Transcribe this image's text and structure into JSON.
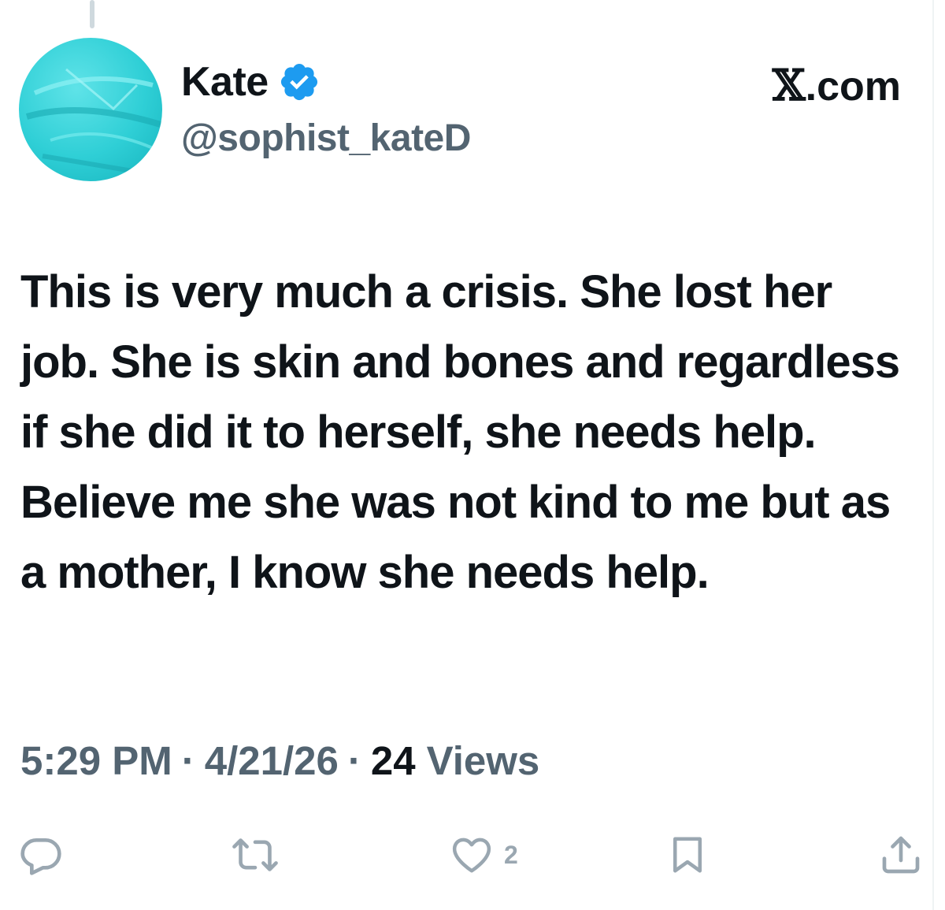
{
  "author": {
    "display_name": "Kate",
    "handle": "@sophist_kateD",
    "verified": true,
    "verified_icon": "verified-badge-icon",
    "avatar_color": "#2fcfd6"
  },
  "source": {
    "logo_letter": "𝕏",
    "domain": ".com"
  },
  "tweet": {
    "text": "This is very much a crisis. She lost her job. She is skin and bones and regardless if she did it to herself, she needs help. Believe me she was not kind to me but as a mother, I know she needs help."
  },
  "meta": {
    "time": "5:29 PM",
    "separator": "·",
    "date": "4/21/26",
    "views_count": "24",
    "views_label": "Views"
  },
  "actions": {
    "reply_icon": "reply-icon",
    "repost_icon": "repost-icon",
    "like_icon": "heart-icon",
    "like_count": "2",
    "bookmark_icon": "bookmark-icon",
    "share_icon": "share-icon"
  },
  "colors": {
    "primary_text": "#0f1419",
    "secondary_text": "#536471",
    "icon_gray": "#9aa7b1",
    "verified_blue": "#1d9bf0"
  }
}
